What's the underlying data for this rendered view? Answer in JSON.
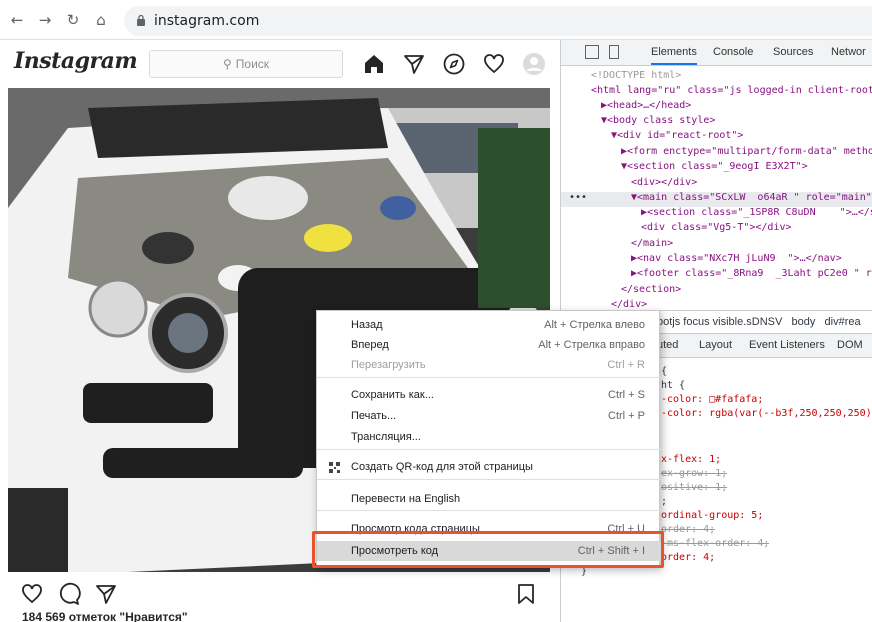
{
  "browser": {
    "url": "instagram.com",
    "nav": {
      "back": "←",
      "forward": "→",
      "reload": "↻",
      "home": "⌂"
    }
  },
  "instagram": {
    "logo": "Instagram",
    "search_placeholder": "Поиск",
    "likes": "184 569 отметок \"Нравится\""
  },
  "devtools": {
    "tabs": [
      "Elements",
      "Console",
      "Sources",
      "Networ"
    ],
    "dom_lines": [
      {
        "text": "<!DOCTYPE html>",
        "indent": 0
      },
      {
        "text": "<html lang=\"ru\" class=\"js logged-in client-root",
        "indent": 0
      },
      {
        "text": "▶<head>…</head>",
        "indent": 1
      },
      {
        "text": "▼<body class style>",
        "indent": 1
      },
      {
        "text": "▼<div id=\"react-root\">",
        "indent": 2
      },
      {
        "text": "▶<form enctype=\"multipart/form-data\" metho",
        "indent": 3
      },
      {
        "text": "▼<section class=\"_9eogI E3X2T\">",
        "indent": 3
      },
      {
        "text": "<div></div>",
        "indent": 4
      },
      {
        "text": "▼<main class=\"SCxLW  o64aR \" role=\"main\">",
        "indent": 4
      },
      {
        "text": "▶<section class=\"_1SP8R C8uDN    \">…</s",
        "indent": 5
      },
      {
        "text": "<div class=\"Vg5-T\"></div>",
        "indent": 5
      },
      {
        "text": "</main>",
        "indent": 4
      },
      {
        "text": "▶<nav class=\"NXc7H jLuN9  \">…</nav>",
        "indent": 4
      },
      {
        "text": "▶<footer class=\"_8Rna9  _3Laht pC2e0 \" r",
        "indent": 4
      },
      {
        "text": "</section>",
        "indent": 3
      },
      {
        "text": "</div>",
        "indent": 2
      }
    ],
    "breadcrumb": "ootjs focus visible.sDNSV   body   div#rea",
    "subtabs": [
      "uted",
      "Layout",
      "Event Listeners",
      "DOM"
    ],
    "style_lines": [
      {
        "text": "{",
        "cls": ""
      },
      {
        "text": "ht {",
        "cls": ""
      },
      {
        "text": "-color: □#fafafa;",
        "cls": "prop"
      },
      {
        "text": "-color: rgba(var(--b3f,250,250,250)",
        "cls": "prop"
      },
      {
        "text": "",
        "cls": ""
      },
      {
        "text": "x-flex: 1;",
        "cls": "prop"
      },
      {
        "text": "ex-grow: 1;",
        "cls": "strike"
      },
      {
        "text": "ositive: 1;",
        "cls": "strike"
      },
      {
        "text": ";",
        "cls": ""
      },
      {
        "text": "ordinal-group: 5;",
        "cls": "prop"
      },
      {
        "text": "order: 4;",
        "cls": "strike"
      },
      {
        "text": "-ms-flex-order: 4;",
        "cls": "strike"
      },
      {
        "text": "order: 4;",
        "cls": "prop"
      },
      {
        "text": "}",
        "cls": ""
      }
    ]
  },
  "context_menu": {
    "items": [
      {
        "label": "Назад",
        "shortcut": "Alt + Стрелка влево",
        "disabled": false
      },
      {
        "label": "Вперед",
        "shortcut": "Alt + Стрелка вправо",
        "disabled": false
      },
      {
        "label": "Перезагрузить",
        "shortcut": "Ctrl + R",
        "disabled": true
      },
      {
        "label": "Сохранить как...",
        "shortcut": "Ctrl + S",
        "disabled": false
      },
      {
        "label": "Печать...",
        "shortcut": "Ctrl + P",
        "disabled": false
      },
      {
        "label": "Трансляция...",
        "shortcut": "",
        "disabled": false
      },
      {
        "label": "Создать QR-код для этой страницы",
        "shortcut": "",
        "disabled": false
      },
      {
        "label": "Перевести на English",
        "shortcut": "",
        "disabled": false
      },
      {
        "label": "Просмотр кода страницы",
        "shortcut": "Ctrl + U",
        "disabled": false
      },
      {
        "label": "Просмотреть код",
        "shortcut": "Ctrl + Shift + I",
        "disabled": false
      }
    ]
  },
  "colors": {
    "highlight": "#e8532f",
    "accent": "#1a73e8"
  }
}
